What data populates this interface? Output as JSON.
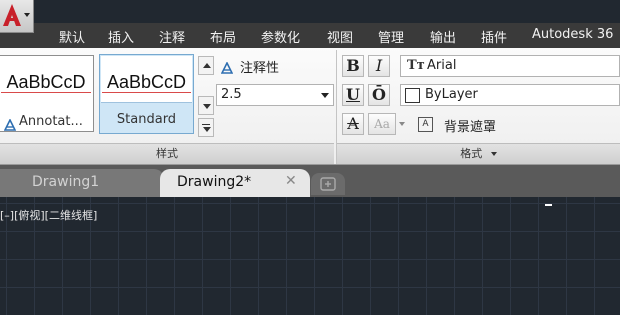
{
  "menu": {
    "items": [
      "默认",
      "插入",
      "注释",
      "布局",
      "参数化",
      "视图",
      "管理",
      "输出",
      "插件",
      "Autodesk 36"
    ]
  },
  "ribbon": {
    "styles_panel": {
      "style_cards": [
        {
          "sample": "AaBbCcD",
          "name": "Annotat..."
        },
        {
          "sample": "AaBbCcD",
          "name": "Standard"
        }
      ],
      "annotative_label": "注释性",
      "height_value": "2.5",
      "footer": "样式"
    },
    "format_panel": {
      "bold": "B",
      "italic": "I",
      "underline": "U",
      "overline": "Ō",
      "strike_label": "A",
      "case_label": "Aa",
      "font_value": "Arial",
      "color_value": "ByLayer",
      "background_mask": "背景遮罩",
      "footer": "格式"
    }
  },
  "tabs": [
    {
      "label": "Drawing1"
    },
    {
      "label": "Drawing2*"
    }
  ],
  "canvas": {
    "viewport_label": "[–][俯视][二维线框]"
  },
  "colors": {
    "accent_red": "#c8202a",
    "canvas_bg": "#212830",
    "menubar_bg": "#3a3a3a",
    "selected_style": "#cfe6f6"
  }
}
